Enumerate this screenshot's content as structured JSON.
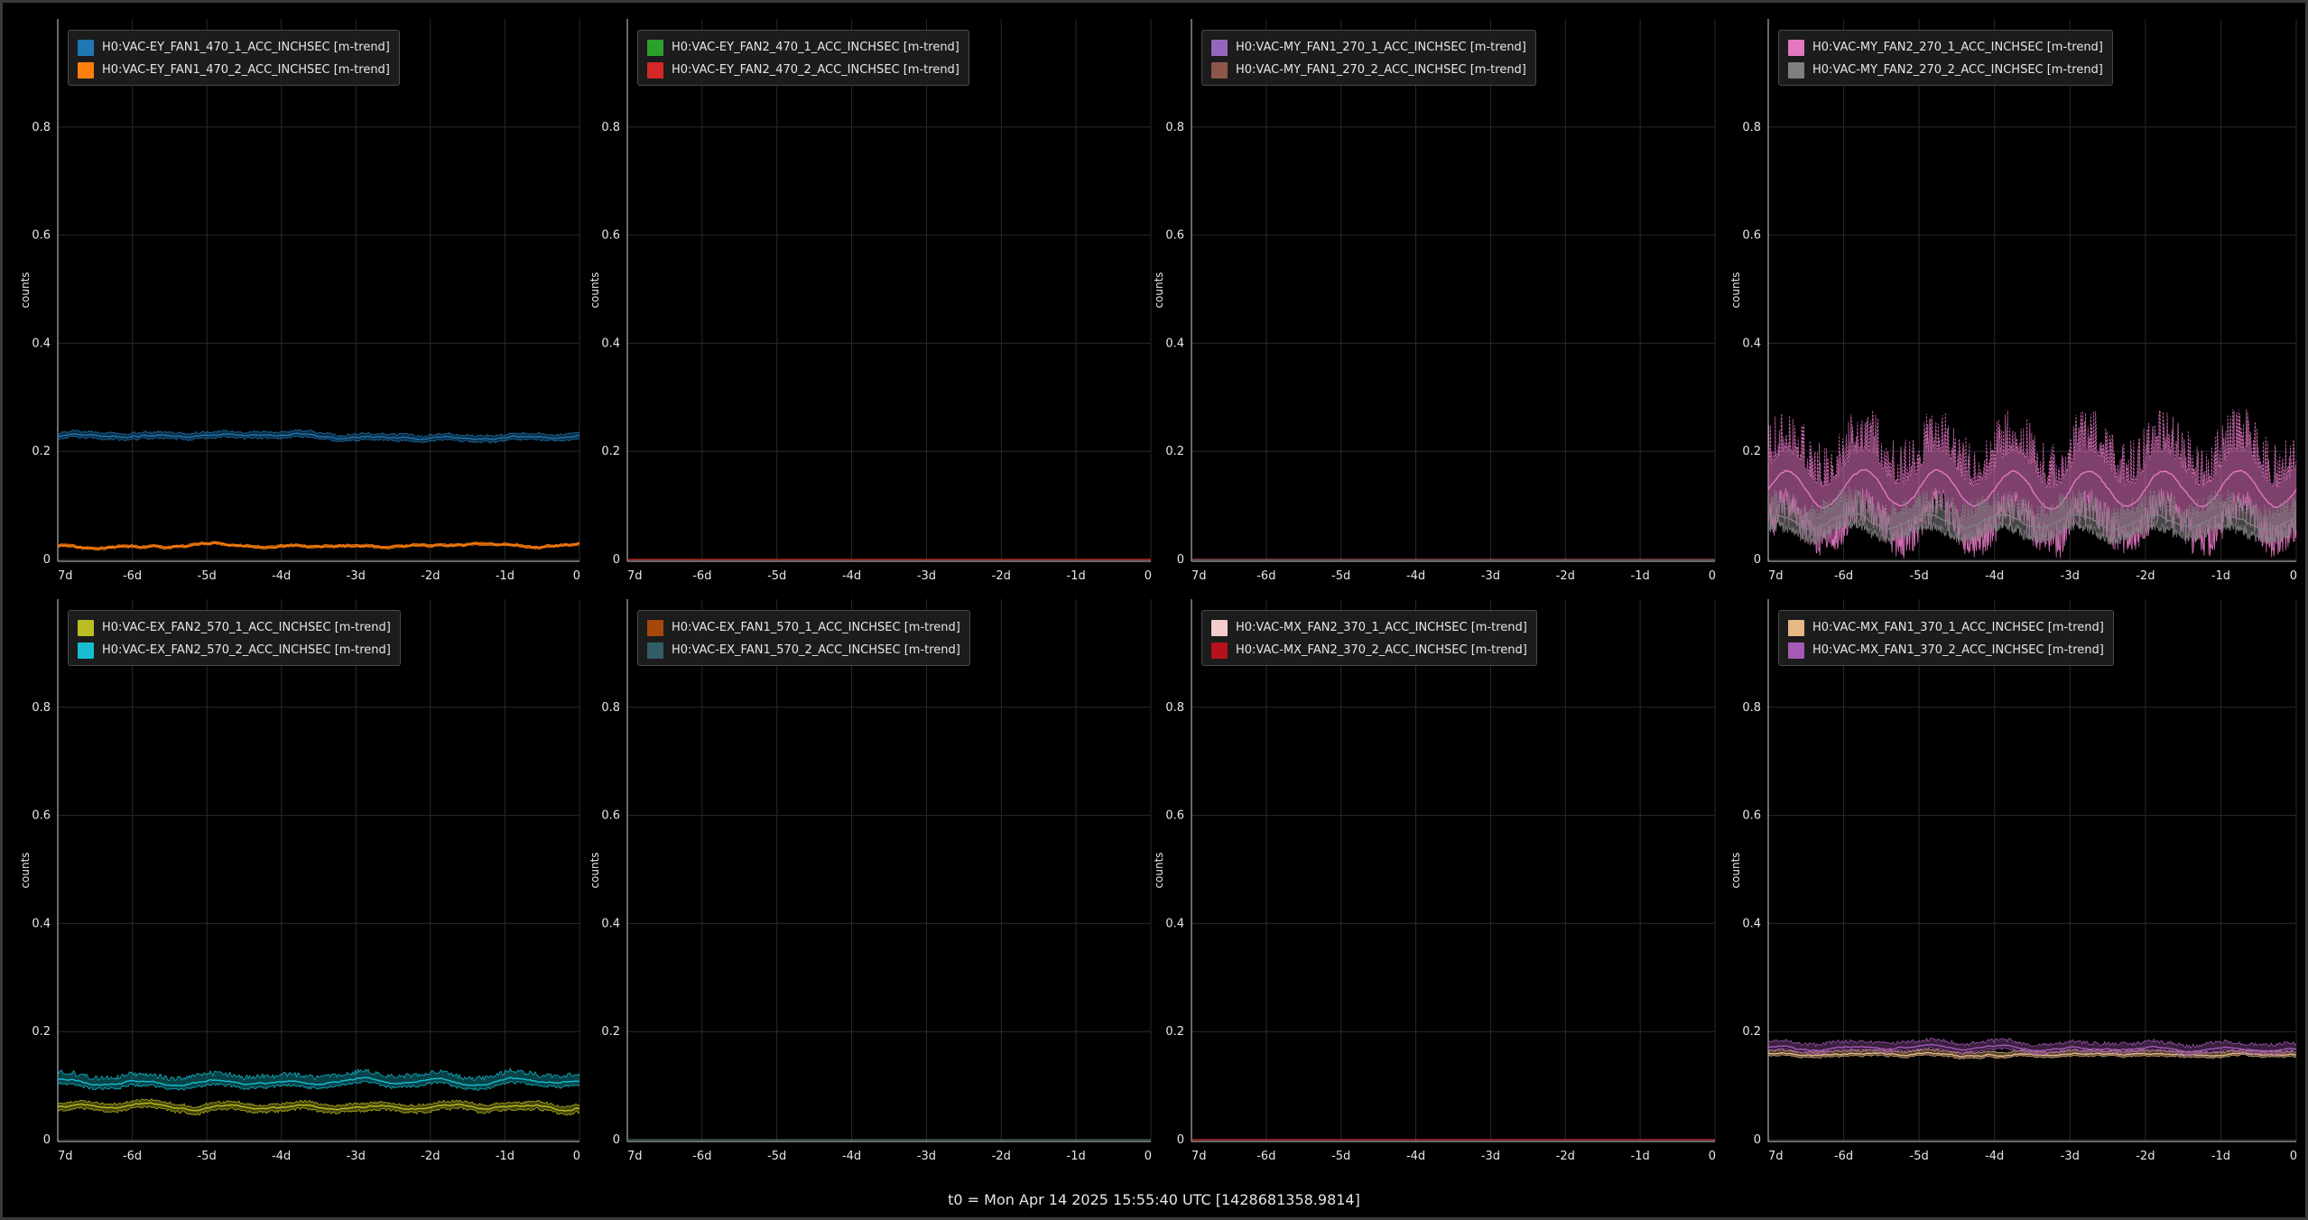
{
  "footer": {
    "t0_label": "t0 = Mon Apr 14 2025 15:55:40 UTC [1428681358.9814]"
  },
  "theme": {
    "background": "#000000",
    "grid": "#2a2a2a",
    "axis": "#cfcfcf",
    "text": "#e6e6e6",
    "legend_bg": "#1e1e1e"
  },
  "chart_data": [
    {
      "type": "line",
      "ylabel": "counts",
      "xlim": [
        -7,
        0
      ],
      "ylim": [
        0,
        1
      ],
      "x_ticks": [
        -7,
        -6,
        -5,
        -4,
        -3,
        -2,
        -1,
        0
      ],
      "x_tick_labels": [
        "7d",
        "-6d",
        "-5d",
        "-4d",
        "-3d",
        "-2d",
        "-1d",
        "0"
      ],
      "y_ticks": [
        0,
        0.2,
        0.4,
        0.6,
        0.8
      ],
      "y_tick_labels": [
        "0",
        "0.2",
        "0.4",
        "0.6",
        "0.8"
      ],
      "grid": true,
      "legend_position": "top-left",
      "series": [
        {
          "name": "H0:VAC-EY_FAN1_470_1_ACC_INCHSEC [m-trend]",
          "color": "#1f77b4",
          "mean": 0.227,
          "min": 0.22,
          "max": 0.235,
          "style": "band"
        },
        {
          "name": "H0:VAC-EY_FAN1_470_2_ACC_INCHSEC [m-trend]",
          "color": "#ff7f0e",
          "mean": 0.025,
          "min": 0.022,
          "max": 0.028,
          "style": "band"
        }
      ]
    },
    {
      "type": "line",
      "ylabel": "counts",
      "xlim": [
        -7,
        0
      ],
      "ylim": [
        0,
        1
      ],
      "x_ticks": [
        -7,
        -6,
        -5,
        -4,
        -3,
        -2,
        -1,
        0
      ],
      "x_tick_labels": [
        "7d",
        "-6d",
        "-5d",
        "-4d",
        "-3d",
        "-2d",
        "-1d",
        "0"
      ],
      "y_ticks": [
        0,
        0.2,
        0.4,
        0.6,
        0.8
      ],
      "y_tick_labels": [
        "0",
        "0.2",
        "0.4",
        "0.6",
        "0.8"
      ],
      "grid": true,
      "legend_position": "top-left",
      "series": [
        {
          "name": "H0:VAC-EY_FAN2_470_1_ACC_INCHSEC [m-trend]",
          "color": "#2ca02c",
          "mean": 0,
          "min": 0,
          "max": 0,
          "style": "flat"
        },
        {
          "name": "H0:VAC-EY_FAN2_470_2_ACC_INCHSEC [m-trend]",
          "color": "#d62728",
          "mean": 0,
          "min": 0,
          "max": 0,
          "style": "flat"
        }
      ]
    },
    {
      "type": "line",
      "ylabel": "counts",
      "xlim": [
        -7,
        0
      ],
      "ylim": [
        0,
        1
      ],
      "x_ticks": [
        -7,
        -6,
        -5,
        -4,
        -3,
        -2,
        -1,
        0
      ],
      "x_tick_labels": [
        "7d",
        "-6d",
        "-5d",
        "-4d",
        "-3d",
        "-2d",
        "-1d",
        "0"
      ],
      "y_ticks": [
        0,
        0.2,
        0.4,
        0.6,
        0.8
      ],
      "y_tick_labels": [
        "0",
        "0.2",
        "0.4",
        "0.6",
        "0.8"
      ],
      "grid": true,
      "legend_position": "top-left",
      "series": [
        {
          "name": "H0:VAC-MY_FAN1_270_1_ACC_INCHSEC [m-trend]",
          "color": "#9467bd",
          "mean": 0,
          "min": 0,
          "max": 0,
          "style": "flat"
        },
        {
          "name": "H0:VAC-MY_FAN1_270_2_ACC_INCHSEC [m-trend]",
          "color": "#8c564b",
          "mean": 0,
          "min": 0,
          "max": 0,
          "style": "flat"
        }
      ]
    },
    {
      "type": "line",
      "ylabel": "counts",
      "xlim": [
        -7,
        0
      ],
      "ylim": [
        0,
        1
      ],
      "x_ticks": [
        -7,
        -6,
        -5,
        -4,
        -3,
        -2,
        -1,
        0
      ],
      "x_tick_labels": [
        "7d",
        "-6d",
        "-5d",
        "-4d",
        "-3d",
        "-2d",
        "-1d",
        "0"
      ],
      "y_ticks": [
        0,
        0.2,
        0.4,
        0.6,
        0.8
      ],
      "y_tick_labels": [
        "0",
        "0.2",
        "0.4",
        "0.6",
        "0.8"
      ],
      "grid": true,
      "legend_position": "top-left",
      "series": [
        {
          "name": "H0:VAC-MY_FAN2_270_1_ACC_INCHSEC [m-trend]",
          "color": "#e377c2",
          "mean": 0.13,
          "min": 0.03,
          "max": 0.25,
          "style": "noisy"
        },
        {
          "name": "H0:VAC-MY_FAN2_270_2_ACC_INCHSEC [m-trend]",
          "color": "#7f7f7f",
          "mean": 0.07,
          "min": 0.04,
          "max": 0.12,
          "style": "noisy"
        }
      ]
    },
    {
      "type": "line",
      "ylabel": "counts",
      "xlim": [
        -7,
        0
      ],
      "ylim": [
        0,
        1
      ],
      "x_ticks": [
        -7,
        -6,
        -5,
        -4,
        -3,
        -2,
        -1,
        0
      ],
      "x_tick_labels": [
        "7d",
        "-6d",
        "-5d",
        "-4d",
        "-3d",
        "-2d",
        "-1d",
        "0"
      ],
      "y_ticks": [
        0,
        0.2,
        0.4,
        0.6,
        0.8
      ],
      "y_tick_labels": [
        "0",
        "0.2",
        "0.4",
        "0.6",
        "0.8"
      ],
      "grid": true,
      "legend_position": "top-left",
      "series": [
        {
          "name": "H0:VAC-EX_FAN2_570_1_ACC_INCHSEC [m-trend]",
          "color": "#bcbd22",
          "mean": 0.061,
          "min": 0.052,
          "max": 0.07,
          "style": "band"
        },
        {
          "name": "H0:VAC-EX_FAN2_570_2_ACC_INCHSEC [m-trend]",
          "color": "#17becf",
          "mean": 0.108,
          "min": 0.098,
          "max": 0.125,
          "style": "band"
        }
      ]
    },
    {
      "type": "line",
      "ylabel": "counts",
      "xlim": [
        -7,
        0
      ],
      "ylim": [
        0,
        1
      ],
      "x_ticks": [
        -7,
        -6,
        -5,
        -4,
        -3,
        -2,
        -1,
        0
      ],
      "x_tick_labels": [
        "7d",
        "-6d",
        "-5d",
        "-4d",
        "-3d",
        "-2d",
        "-1d",
        "0"
      ],
      "y_ticks": [
        0,
        0.2,
        0.4,
        0.6,
        0.8
      ],
      "y_tick_labels": [
        "0",
        "0.2",
        "0.4",
        "0.6",
        "0.8"
      ],
      "grid": true,
      "legend_position": "top-left",
      "series": [
        {
          "name": "H0:VAC-EX_FAN1_570_1_ACC_INCHSEC [m-trend]",
          "color": "#a6470b",
          "mean": 0,
          "min": 0,
          "max": 0,
          "style": "flat"
        },
        {
          "name": "H0:VAC-EX_FAN1_570_2_ACC_INCHSEC [m-trend]",
          "color": "#315d67",
          "mean": 0,
          "min": 0,
          "max": 0,
          "style": "flat"
        }
      ]
    },
    {
      "type": "line",
      "ylabel": "counts",
      "xlim": [
        -7,
        0
      ],
      "ylim": [
        0,
        1
      ],
      "x_ticks": [
        -7,
        -6,
        -5,
        -4,
        -3,
        -2,
        -1,
        0
      ],
      "x_tick_labels": [
        "7d",
        "-6d",
        "-5d",
        "-4d",
        "-3d",
        "-2d",
        "-1d",
        "0"
      ],
      "y_ticks": [
        0,
        0.2,
        0.4,
        0.6,
        0.8
      ],
      "y_tick_labels": [
        "0",
        "0.2",
        "0.4",
        "0.6",
        "0.8"
      ],
      "grid": true,
      "legend_position": "top-left",
      "series": [
        {
          "name": "H0:VAC-MX_FAN2_370_1_ACC_INCHSEC [m-trend]",
          "color": "#f4cccc",
          "mean": 0,
          "min": 0,
          "max": 0,
          "style": "flat"
        },
        {
          "name": "H0:VAC-MX_FAN2_370_2_ACC_INCHSEC [m-trend]",
          "color": "#b5121b",
          "mean": 0,
          "min": 0,
          "max": 0,
          "style": "flat"
        }
      ]
    },
    {
      "type": "line",
      "ylabel": "counts",
      "xlim": [
        -7,
        0
      ],
      "ylim": [
        0,
        1
      ],
      "x_ticks": [
        -7,
        -6,
        -5,
        -4,
        -3,
        -2,
        -1,
        0
      ],
      "x_tick_labels": [
        "7d",
        "-6d",
        "-5d",
        "-4d",
        "-3d",
        "-2d",
        "-1d",
        "0"
      ],
      "y_ticks": [
        0,
        0.2,
        0.4,
        0.6,
        0.8
      ],
      "y_tick_labels": [
        "0",
        "0.2",
        "0.4",
        "0.6",
        "0.8"
      ],
      "grid": true,
      "legend_position": "top-left",
      "series": [
        {
          "name": "H0:VAC-MX_FAN1_370_1_ACC_INCHSEC [m-trend]",
          "color": "#e5b886",
          "mean": 0.16,
          "min": 0.155,
          "max": 0.168,
          "style": "band"
        },
        {
          "name": "H0:VAC-MX_FAN1_370_2_ACC_INCHSEC [m-trend]",
          "color": "#a55ab5",
          "mean": 0.168,
          "min": 0.16,
          "max": 0.182,
          "style": "band"
        }
      ]
    }
  ]
}
